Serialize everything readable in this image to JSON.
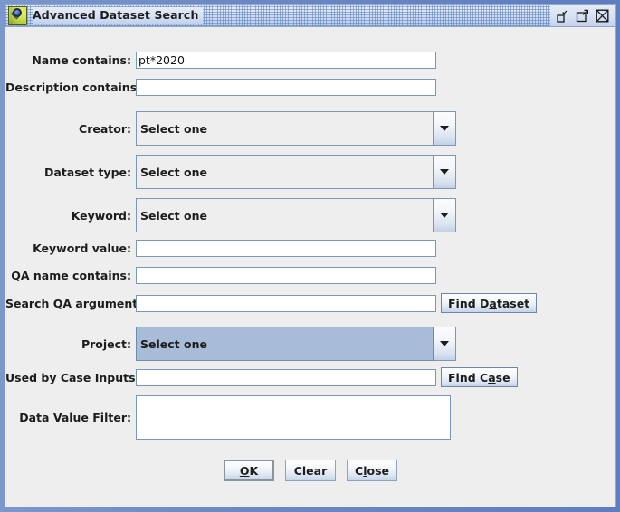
{
  "window": {
    "title": "Advanced Dataset Search",
    "icon": "magnifier-dataset-icon",
    "controls": {
      "minimize": "minimize-icon",
      "maximize": "maximize-icon",
      "close": "close-icon"
    },
    "frame_color": "#6b88c4",
    "background_color": "#eeeeee"
  },
  "form": {
    "name_contains": {
      "label": "Name contains:",
      "value": "pt*2020",
      "placeholder": ""
    },
    "description_contains": {
      "label": "Description contains:",
      "value": "",
      "placeholder": ""
    },
    "creator": {
      "label": "Creator:",
      "selected": "Select one",
      "options": [
        "Select one"
      ]
    },
    "dataset_type": {
      "label": "Dataset type:",
      "selected": "Select one",
      "options": [
        "Select one"
      ]
    },
    "keyword": {
      "label": "Keyword:",
      "selected": "Select one",
      "options": [
        "Select one"
      ]
    },
    "keyword_value": {
      "label": "Keyword value:",
      "value": "",
      "placeholder": ""
    },
    "qa_name_contains": {
      "label": "QA name contains:",
      "value": "",
      "placeholder": ""
    },
    "search_qa_arguments": {
      "label": "Search QA arguments:",
      "value": "",
      "placeholder": ""
    },
    "find_dataset_button": {
      "label_before": "Find D",
      "mnemonic": "a",
      "label_after": "taset"
    },
    "project": {
      "label": "Project:",
      "selected": "Select one",
      "options": [
        "Select one"
      ],
      "highlight_color": "#a7bcd7",
      "focused": true
    },
    "used_by_case_inputs": {
      "label": "Used by Case Inputs:",
      "value": "",
      "placeholder": ""
    },
    "find_case_button": {
      "label_before": "Find C",
      "mnemonic": "a",
      "label_after": "se"
    },
    "data_value_filter": {
      "label": "Data Value Filter:",
      "value": "",
      "placeholder": ""
    }
  },
  "buttons": {
    "ok": {
      "mnemonic": "O",
      "label_after": "K",
      "focused": true
    },
    "clear": {
      "label": "Clear"
    },
    "close": {
      "label_before": "C",
      "mnemonic": "l",
      "label_after": "ose"
    }
  }
}
